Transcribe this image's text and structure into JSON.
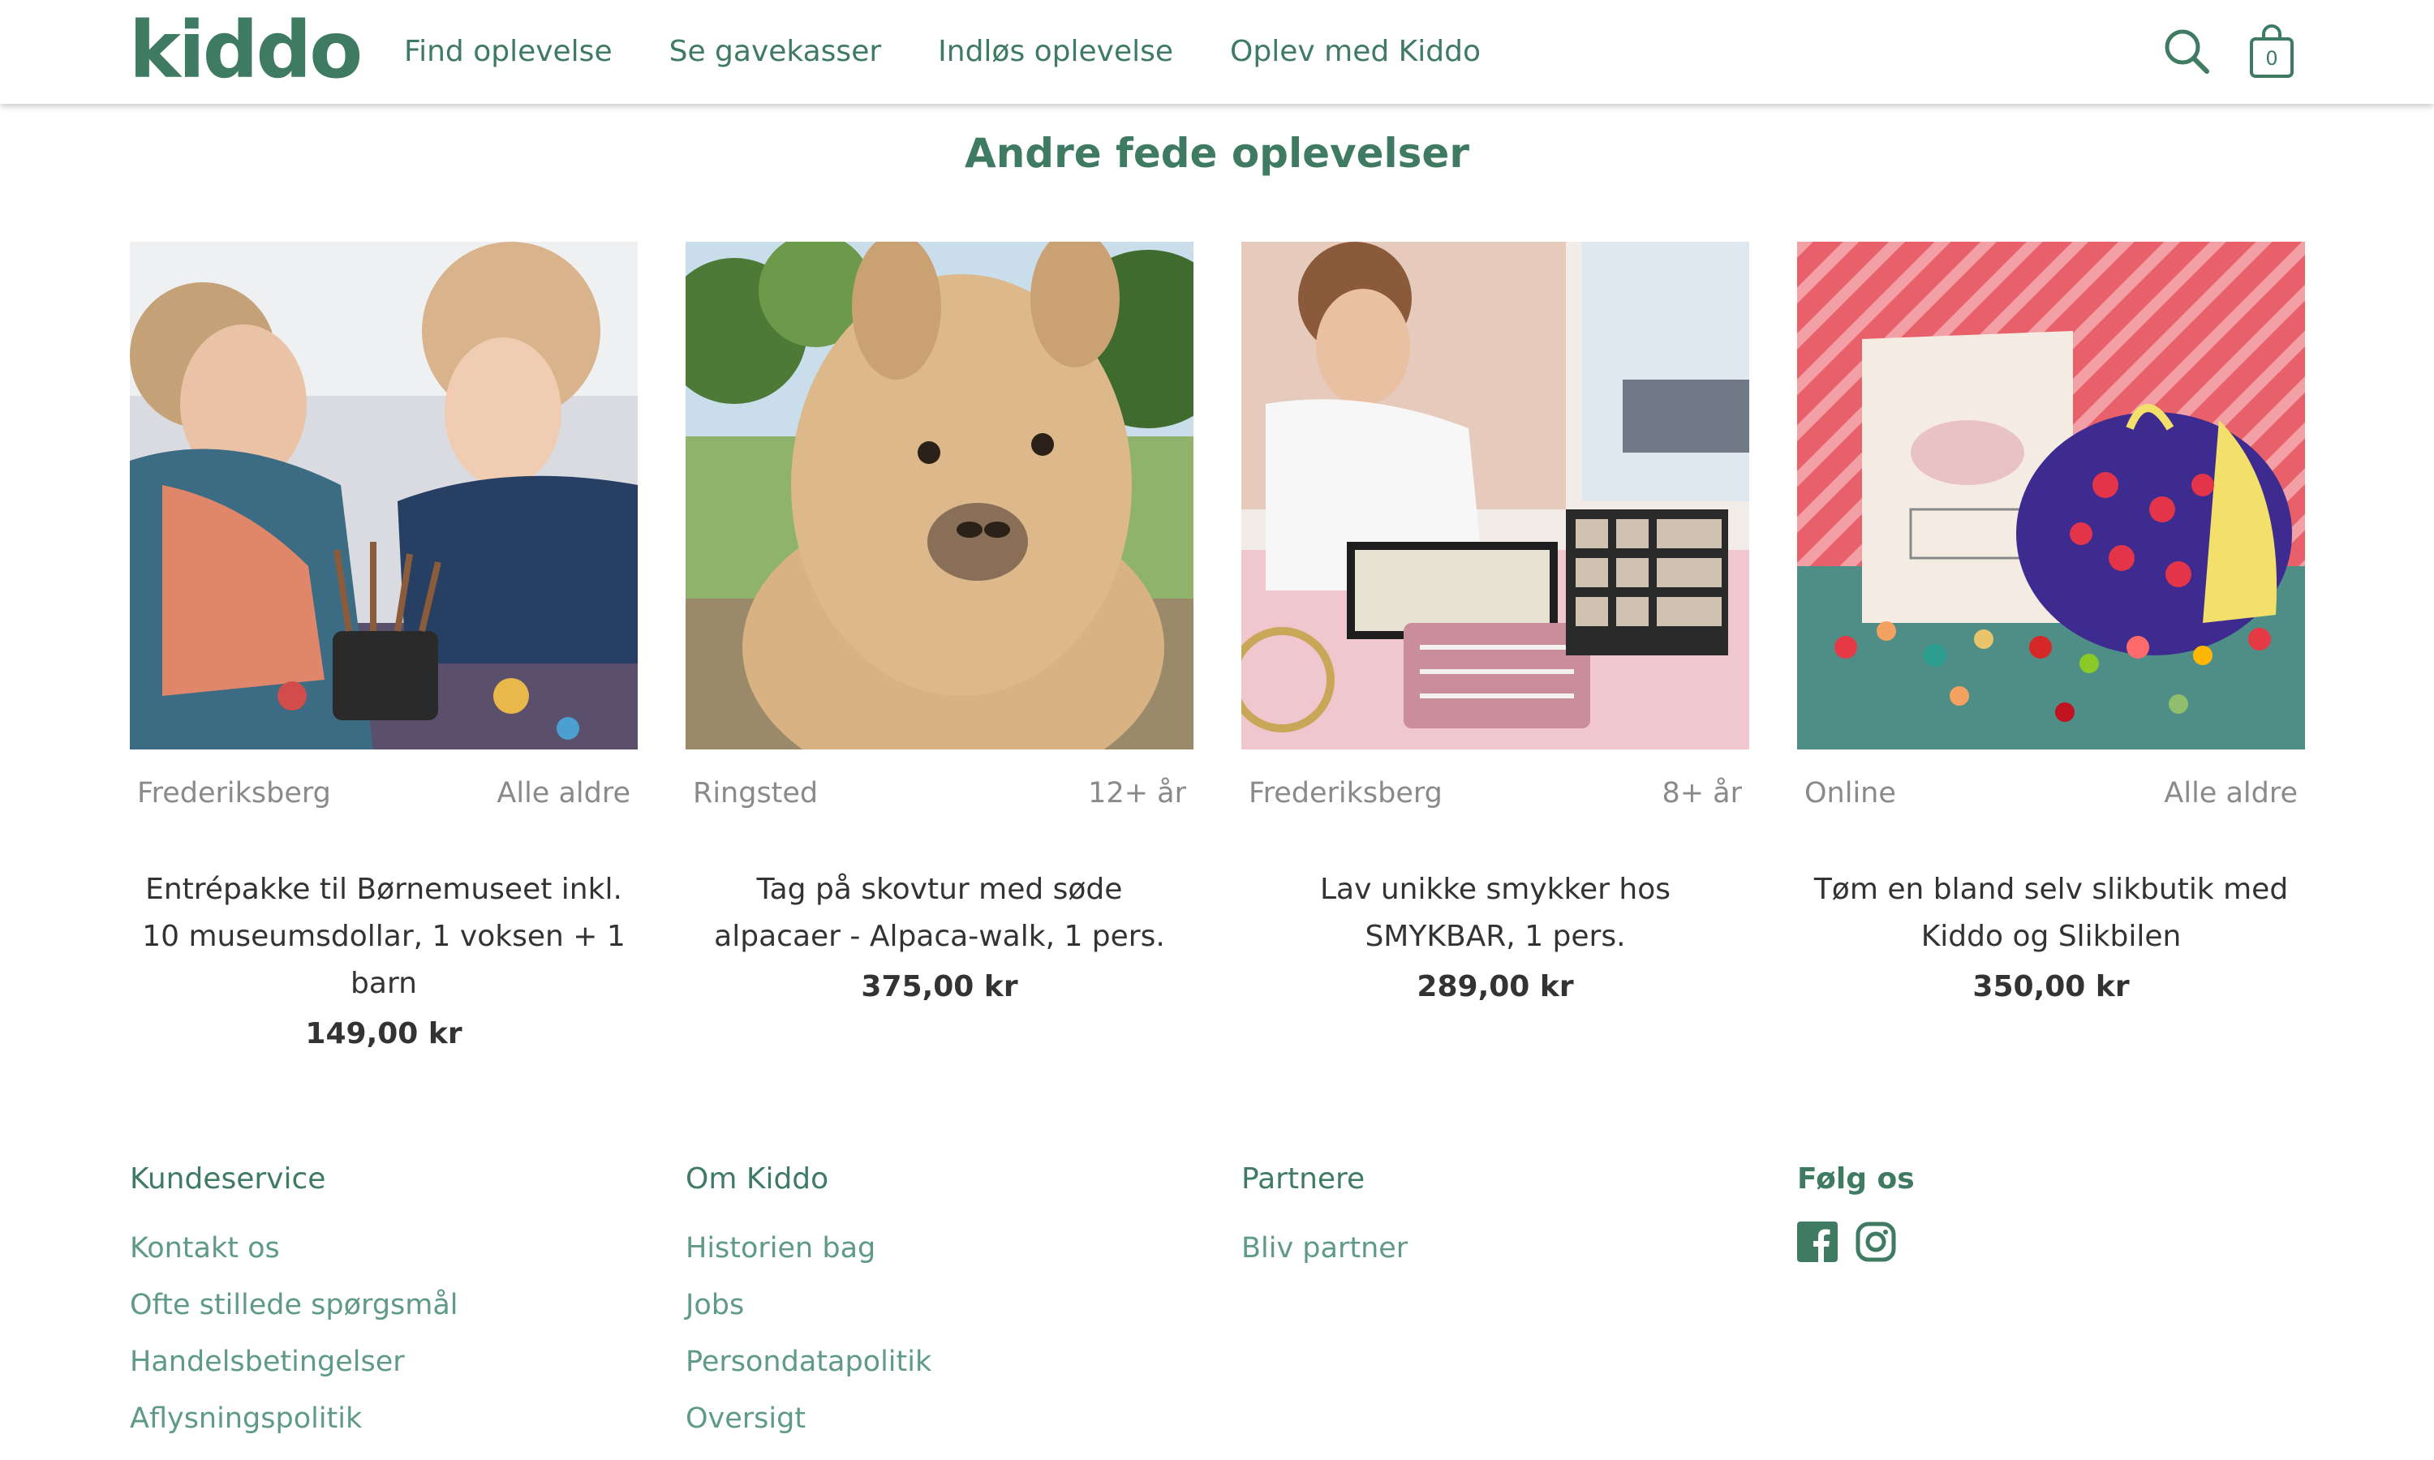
{
  "header": {
    "logo": "kiddo",
    "nav": [
      "Find oplevelse",
      "Se gavekasser",
      "Indløs oplevelse",
      "Oplev med Kiddo"
    ],
    "cart_count": "0"
  },
  "section_title": "Andre fede oplevelser",
  "products": [
    {
      "location": "Frederiksberg",
      "age": "Alle aldre",
      "title": "Entrépakke til Børnemuseet inkl. 10 museumsdollar, 1 voksen + 1 barn",
      "price": "149,00 kr"
    },
    {
      "location": "Ringsted",
      "age": "12+ år",
      "title": "Tag på skovtur med søde alpacaer - Alpaca-walk, 1 pers.",
      "price": "375,00 kr"
    },
    {
      "location": "Frederiksberg",
      "age": "8+ år",
      "title": "Lav unikke smykker hos SMYKBAR, 1 pers.",
      "price": "289,00 kr"
    },
    {
      "location": "Online",
      "age": "Alle aldre",
      "title": "Tøm en bland selv slikbutik med Kiddo og Slikbilen",
      "price": "350,00 kr"
    }
  ],
  "footer": {
    "customer_service": {
      "heading": "Kundeservice",
      "links": [
        "Kontakt os",
        "Ofte stillede spørgsmål",
        "Handelsbetingelser",
        "Aflysningspolitik"
      ]
    },
    "about": {
      "heading": "Om Kiddo",
      "links": [
        "Historien bag",
        "Jobs",
        "Persondatapolitik",
        "Oversigt"
      ]
    },
    "partners": {
      "heading": "Partnere",
      "links": [
        "Bliv partner"
      ]
    },
    "follow": {
      "heading": "Følg os",
      "icons": [
        "facebook-icon",
        "instagram-icon"
      ]
    }
  },
  "colors": {
    "brand": "#3f7a63",
    "link": "#5f9a84",
    "muted": "#8a8a8a"
  }
}
